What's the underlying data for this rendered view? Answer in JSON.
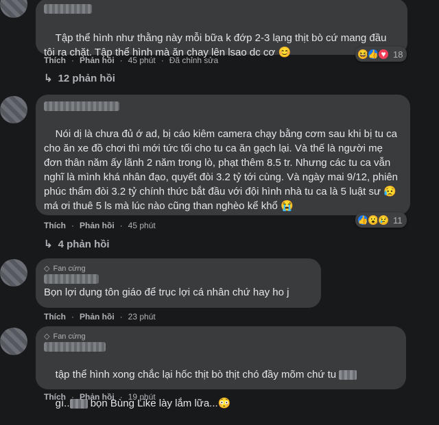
{
  "comments": [
    {
      "text": "Tập thể hình như thằng này mỗi bữa k đớp 2-3 lạng thịt bò cứ mang đầu tôi ra chặt. Tập thể hình mà ăn chay lên lsao dc cơ",
      "emoji": "😊",
      "like": "Thích",
      "reply": "Phản hồi",
      "time": "45 phút",
      "edited": "Đã chỉnh sửa",
      "reaction_count": "18",
      "replies_label": "12 phản hồi"
    },
    {
      "text": "Nói dị là chưa đủ ớ ad, bị cáo kiêm camera chạy bằng cơm sau khi bị tu ca cho ăn xe đồ chơi thì mới tức tối cho tu ca ăn gạch lại. Và thế là người mẹ đơn thân năm ấy lãnh 2 năm trong lò, phạt thêm 8.5 tr. Nhưng các tu ca vẫn nghĩ là mình khá nhân đạo, quyết đòi 3.2 tỷ tới cùng. Và ngày mai 9/12, phiên phúc thẩm đòi 3.2 tỷ chính thức bắt đầu với đội hình nhà tu ca là 5 luật sư",
      "text_tail": " má ơi thuê 5 ls mà lúc nào cũng than nghèo kể khổ ",
      "emoji1": "😥",
      "emoji2": "😭",
      "like": "Thích",
      "reply": "Phản hồi",
      "time": "45 phút",
      "reaction_count": "11",
      "replies_label": "4 phản hồi"
    },
    {
      "badge": "Fan cứng",
      "text": "Bọn lợi dụng tôn giáo để trục lợi cá nhân chứ hay ho j",
      "like": "Thích",
      "reply": "Phản hồi",
      "time": "23 phút"
    },
    {
      "badge": "Fan cứng",
      "text_a": "tập thể hình xong chắc lại hốc thịt bò thịt chó đầy mõm chứ tu",
      "text_b": "gì..",
      "text_c": " bọn Bùng Like lày lắm lữa...",
      "emoji": "😳",
      "like": "Thích",
      "reply": "Phản hồi",
      "time": "19 phút"
    }
  ],
  "colors": {
    "bg": "#18191a",
    "bubble": "#3a3b3c",
    "muted": "#b0b3b8",
    "text": "#e4e6eb"
  }
}
